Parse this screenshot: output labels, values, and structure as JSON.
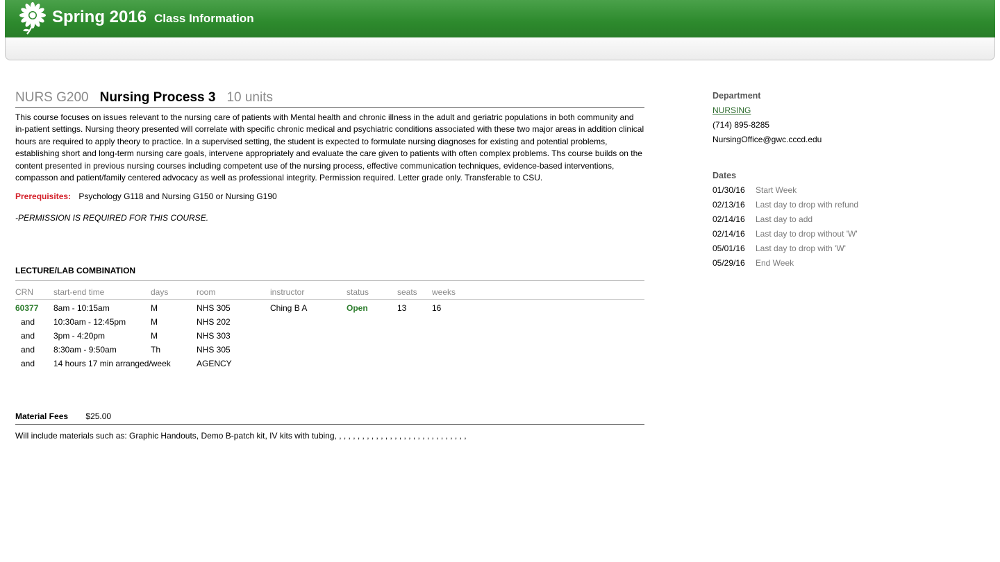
{
  "header": {
    "season": "Spring 2016",
    "page_title": "Class Information",
    "brand_color": "#2d8a2d"
  },
  "course": {
    "code": "NURS G200",
    "name": "Nursing Process 3",
    "units": "10 units",
    "description": "This course focuses on issues relevant to the nursing care of patients with Mental health and chronic illness in the adult and geriatric populations in both community and in-patient settings. Nursing theory presented will correlate with specific chronic medical and psychiatric conditions associated with these two major areas in addition clinical hours are required to apply theory to practice. In a supervised setting, the student is expected to formulate nursing diagnoses for existing and potential problems, establishing short and long-term nursing care goals, intervene appropriately and evaluate the care given to patients with often complex problems. Ths course builds on the content presented in previous nursing courses including competent use of the nursing process, effective communication techniques, evidence-based interventions, compasson and patient/family centered advocacy as well as professional integrity. Permission required. Letter grade only. Transferable to CSU.",
    "prereq_label": "Prerequisites:",
    "prereq_value": "Psychology G118 and Nursing G150 or Nursing G190",
    "permission_note": "-PERMISSION IS REQUIRED FOR THIS COURSE."
  },
  "schedule": {
    "title": "LECTURE/LAB COMBINATION",
    "columns": [
      "CRN",
      "start-end time",
      "days",
      "room",
      "instructor",
      "status",
      "seats",
      "weeks"
    ],
    "rows": [
      {
        "crn": "60377",
        "time": "8am - 10:15am",
        "days": "M",
        "room": "NHS 305",
        "instructor": "Ching B A",
        "status": "Open",
        "seats": "13",
        "weeks": "16"
      },
      {
        "crn": "and",
        "time": "10:30am - 12:45pm",
        "days": "M",
        "room": "NHS 202"
      },
      {
        "crn": "and",
        "time": "3pm - 4:20pm",
        "days": "M",
        "room": "NHS 303"
      },
      {
        "crn": "and",
        "time": "8:30am - 9:50am",
        "days": "Th",
        "room": "NHS 305"
      },
      {
        "crn": "and",
        "time": "14 hours 17 min arranged/week",
        "days": "",
        "room": "AGENCY"
      }
    ]
  },
  "fees": {
    "label": "Material Fees",
    "amount": "$25.00",
    "note": "Will include materials such as: Graphic Handouts, Demo B-patch kit, IV kits with tubing, , , , , , , , , , , , , , , , , , , , , , , , , , , , ,"
  },
  "department": {
    "heading": "Department",
    "name": "NURSING",
    "phone": "(714) 895-8285",
    "email": "NursingOffice@gwc.cccd.edu"
  },
  "dates": {
    "heading": "Dates",
    "items": [
      {
        "date": "01/30/16",
        "label": "Start Week"
      },
      {
        "date": "02/13/16",
        "label": "Last day to drop with refund"
      },
      {
        "date": "02/14/16",
        "label": "Last day to add"
      },
      {
        "date": "02/14/16",
        "label": "Last day to drop without 'W'"
      },
      {
        "date": "05/01/16",
        "label": "Last day to drop with 'W'"
      },
      {
        "date": "05/29/16",
        "label": "End Week"
      }
    ]
  }
}
